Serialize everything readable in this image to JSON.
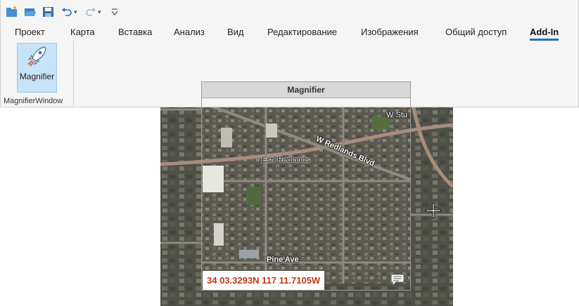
{
  "quick_access": {
    "icons": [
      "new-project-icon",
      "open-project-icon",
      "save-project-icon",
      "undo-icon",
      "redo-icon",
      "customize-toolbar-icon"
    ]
  },
  "tabs": [
    {
      "label": "Проект"
    },
    {
      "label": "Карта"
    },
    {
      "label": "Вставка"
    },
    {
      "label": "Анализ"
    },
    {
      "label": "Вид"
    },
    {
      "label": "Редактирование"
    },
    {
      "label": "Изображения"
    },
    {
      "label": "Общий доступ"
    },
    {
      "label": "Add-In",
      "active": true
    }
  ],
  "ribbon": {
    "button_label": "Magnifier",
    "group_label": "MagnifierWindow"
  },
  "magnifier": {
    "title": "Magnifier",
    "coordinates": "34 03.3293N 117 11.7105W"
  },
  "map_labels": {
    "street_east": "W Stu",
    "boulevard": "W Redlands Blvd",
    "place": "Esri Redlands",
    "avenue": "Pine Ave"
  },
  "colors": {
    "accent": "#1e6fc2",
    "button_bg": "#c7e3f7",
    "coordinate_text": "#c0361a"
  }
}
